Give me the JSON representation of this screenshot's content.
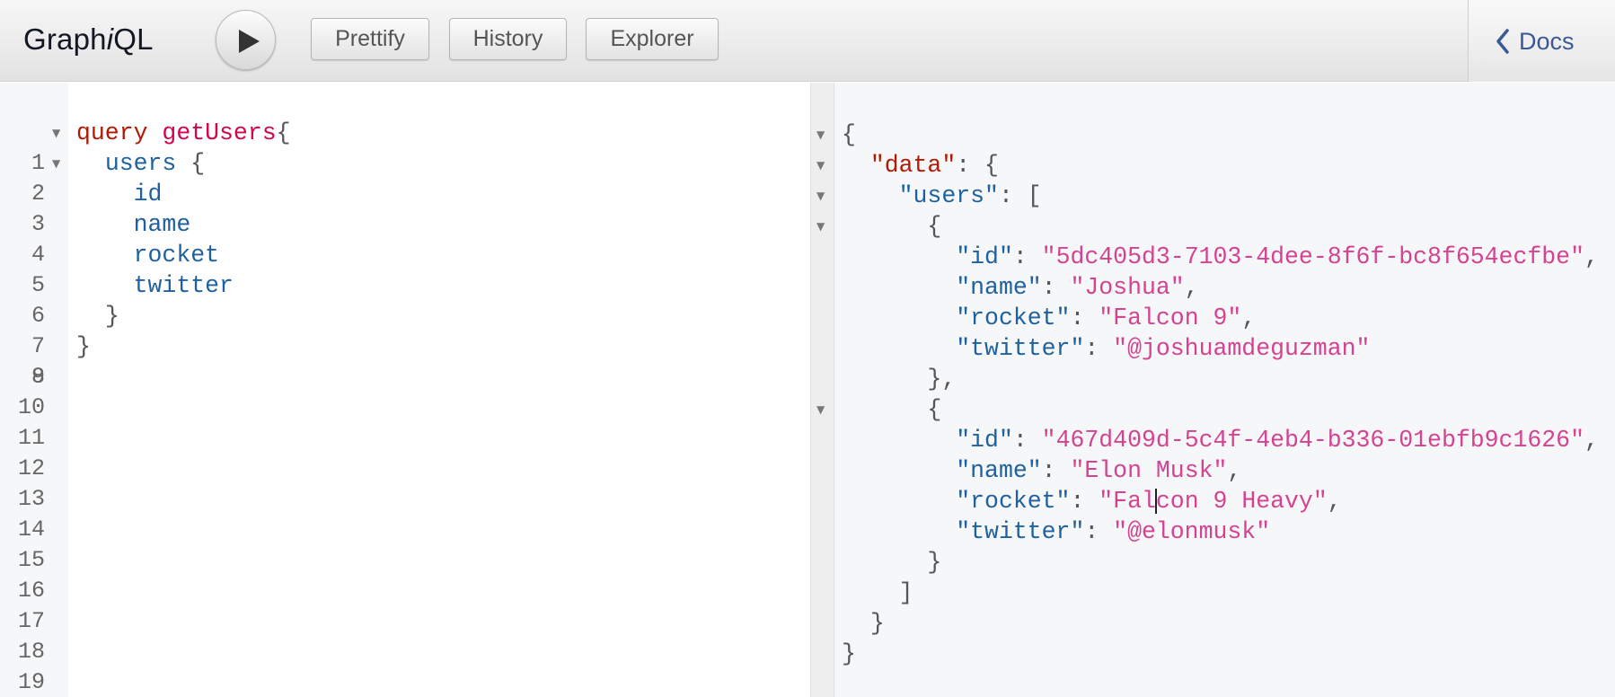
{
  "toolbar": {
    "logo_prefix": "Graph",
    "logo_italic": "i",
    "logo_suffix": "QL",
    "prettify_label": "Prettify",
    "history_label": "History",
    "explorer_label": "Explorer",
    "docs_label": "Docs"
  },
  "query": {
    "line_numbers": [
      "1",
      "2",
      "3",
      "4",
      "5",
      "6",
      "7",
      "8",
      "9",
      "10",
      "11",
      "12",
      "13",
      "14",
      "15",
      "16",
      "17",
      "18",
      "19"
    ],
    "keyword": "query",
    "op_name": "getUsers",
    "open_brace": "{",
    "root_field": "users",
    "root_open": " {",
    "fields": [
      "id",
      "name",
      "rocket",
      "twitter"
    ],
    "inner_close": "}",
    "outer_close": "}"
  },
  "result": {
    "open": "{",
    "data_key": "\"data\"",
    "data_open": ": {",
    "users_key": "\"users\"",
    "users_open": ": [",
    "obj_open": "{",
    "obj_close_comma": "},",
    "obj_close": "}",
    "arr_close": "]",
    "data_close": "}",
    "close": "}",
    "key_id": "\"id\"",
    "key_name": "\"name\"",
    "key_rocket": "\"rocket\"",
    "key_twitter": "\"twitter\"",
    "colon": ": ",
    "comma": ",",
    "user1": {
      "id": "\"5dc405d3-7103-4dee-8f6f-bc8f654ecfbe\"",
      "name": "\"Joshua\"",
      "rocket": "\"Falcon 9\"",
      "twitter": "\"@joshuamdeguzman\""
    },
    "user2": {
      "id": "\"467d409d-5c4f-4eb4-b336-01ebfb9c1626\"",
      "name": "\"Elon Musk\"",
      "rocket_before_cursor": "\"Fal",
      "rocket_after_cursor": "con 9 Heavy\"",
      "twitter": "\"@elonmusk\""
    }
  }
}
